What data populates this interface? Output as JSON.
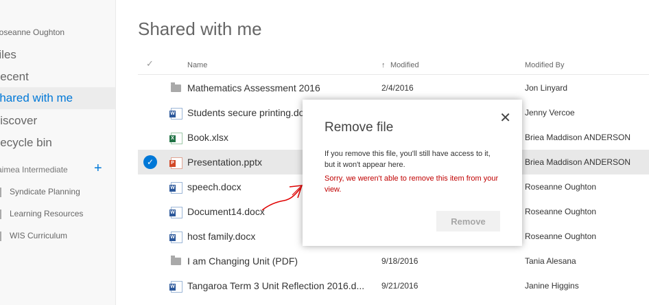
{
  "sidebar": {
    "user_name": "Roseanne Oughton",
    "nav": [
      {
        "label": "Files"
      },
      {
        "label": "Recent"
      },
      {
        "label": "Shared with me"
      },
      {
        "label": "Discover"
      },
      {
        "label": "Recycle bin"
      }
    ],
    "group_title": "Kaimea Intermediate",
    "group_plus": "+",
    "group_items": [
      {
        "label": "Syndicate Planning"
      },
      {
        "label": "Learning Resources"
      },
      {
        "label": "WIS Curriculum"
      }
    ]
  },
  "main": {
    "title": "Shared with me",
    "columns": {
      "check": "✓",
      "name": "Name",
      "modified": "Modified",
      "sort_icon": "↑",
      "modified_by": "Modified By"
    },
    "rows": [
      {
        "name": "Mathematics Assessment 2016",
        "modified": "2/4/2016",
        "by": "Jon Linyard",
        "type": "folder"
      },
      {
        "name": "Students secure printing.do",
        "modified": "",
        "by": "Jenny Vercoe",
        "type": "docx"
      },
      {
        "name": "Book.xlsx",
        "modified": "",
        "by": "Briea Maddison ANDERSON",
        "type": "xlsx"
      },
      {
        "name": "Presentation.pptx",
        "modified": "",
        "by": "Briea Maddison ANDERSON",
        "type": "pptx",
        "selected": true
      },
      {
        "name": "speech.docx",
        "modified": "",
        "by": "Roseanne Oughton",
        "type": "docx"
      },
      {
        "name": "Document14.docx",
        "modified": "",
        "by": "Roseanne Oughton",
        "type": "docx"
      },
      {
        "name": "host family.docx",
        "modified": "",
        "by": "Roseanne Oughton",
        "type": "docx"
      },
      {
        "name": "I am Changing Unit (PDF)",
        "modified": "9/18/2016",
        "by": "Tania Alesana",
        "type": "folder"
      },
      {
        "name": "Tangaroa Term 3 Unit Reflection 2016.d...",
        "modified": "9/21/2016",
        "by": "Janine Higgins",
        "type": "docx"
      }
    ]
  },
  "dialog": {
    "title": "Remove file",
    "message": "If you remove this file, you'll still have access to it, but it won't appear here.",
    "error": "Sorry, we weren't able to remove this item from your view.",
    "button": "Remove",
    "close": "✕"
  },
  "colors": {
    "accent": "#0078d7",
    "error": "#c00000",
    "annotation": "#e00000"
  }
}
